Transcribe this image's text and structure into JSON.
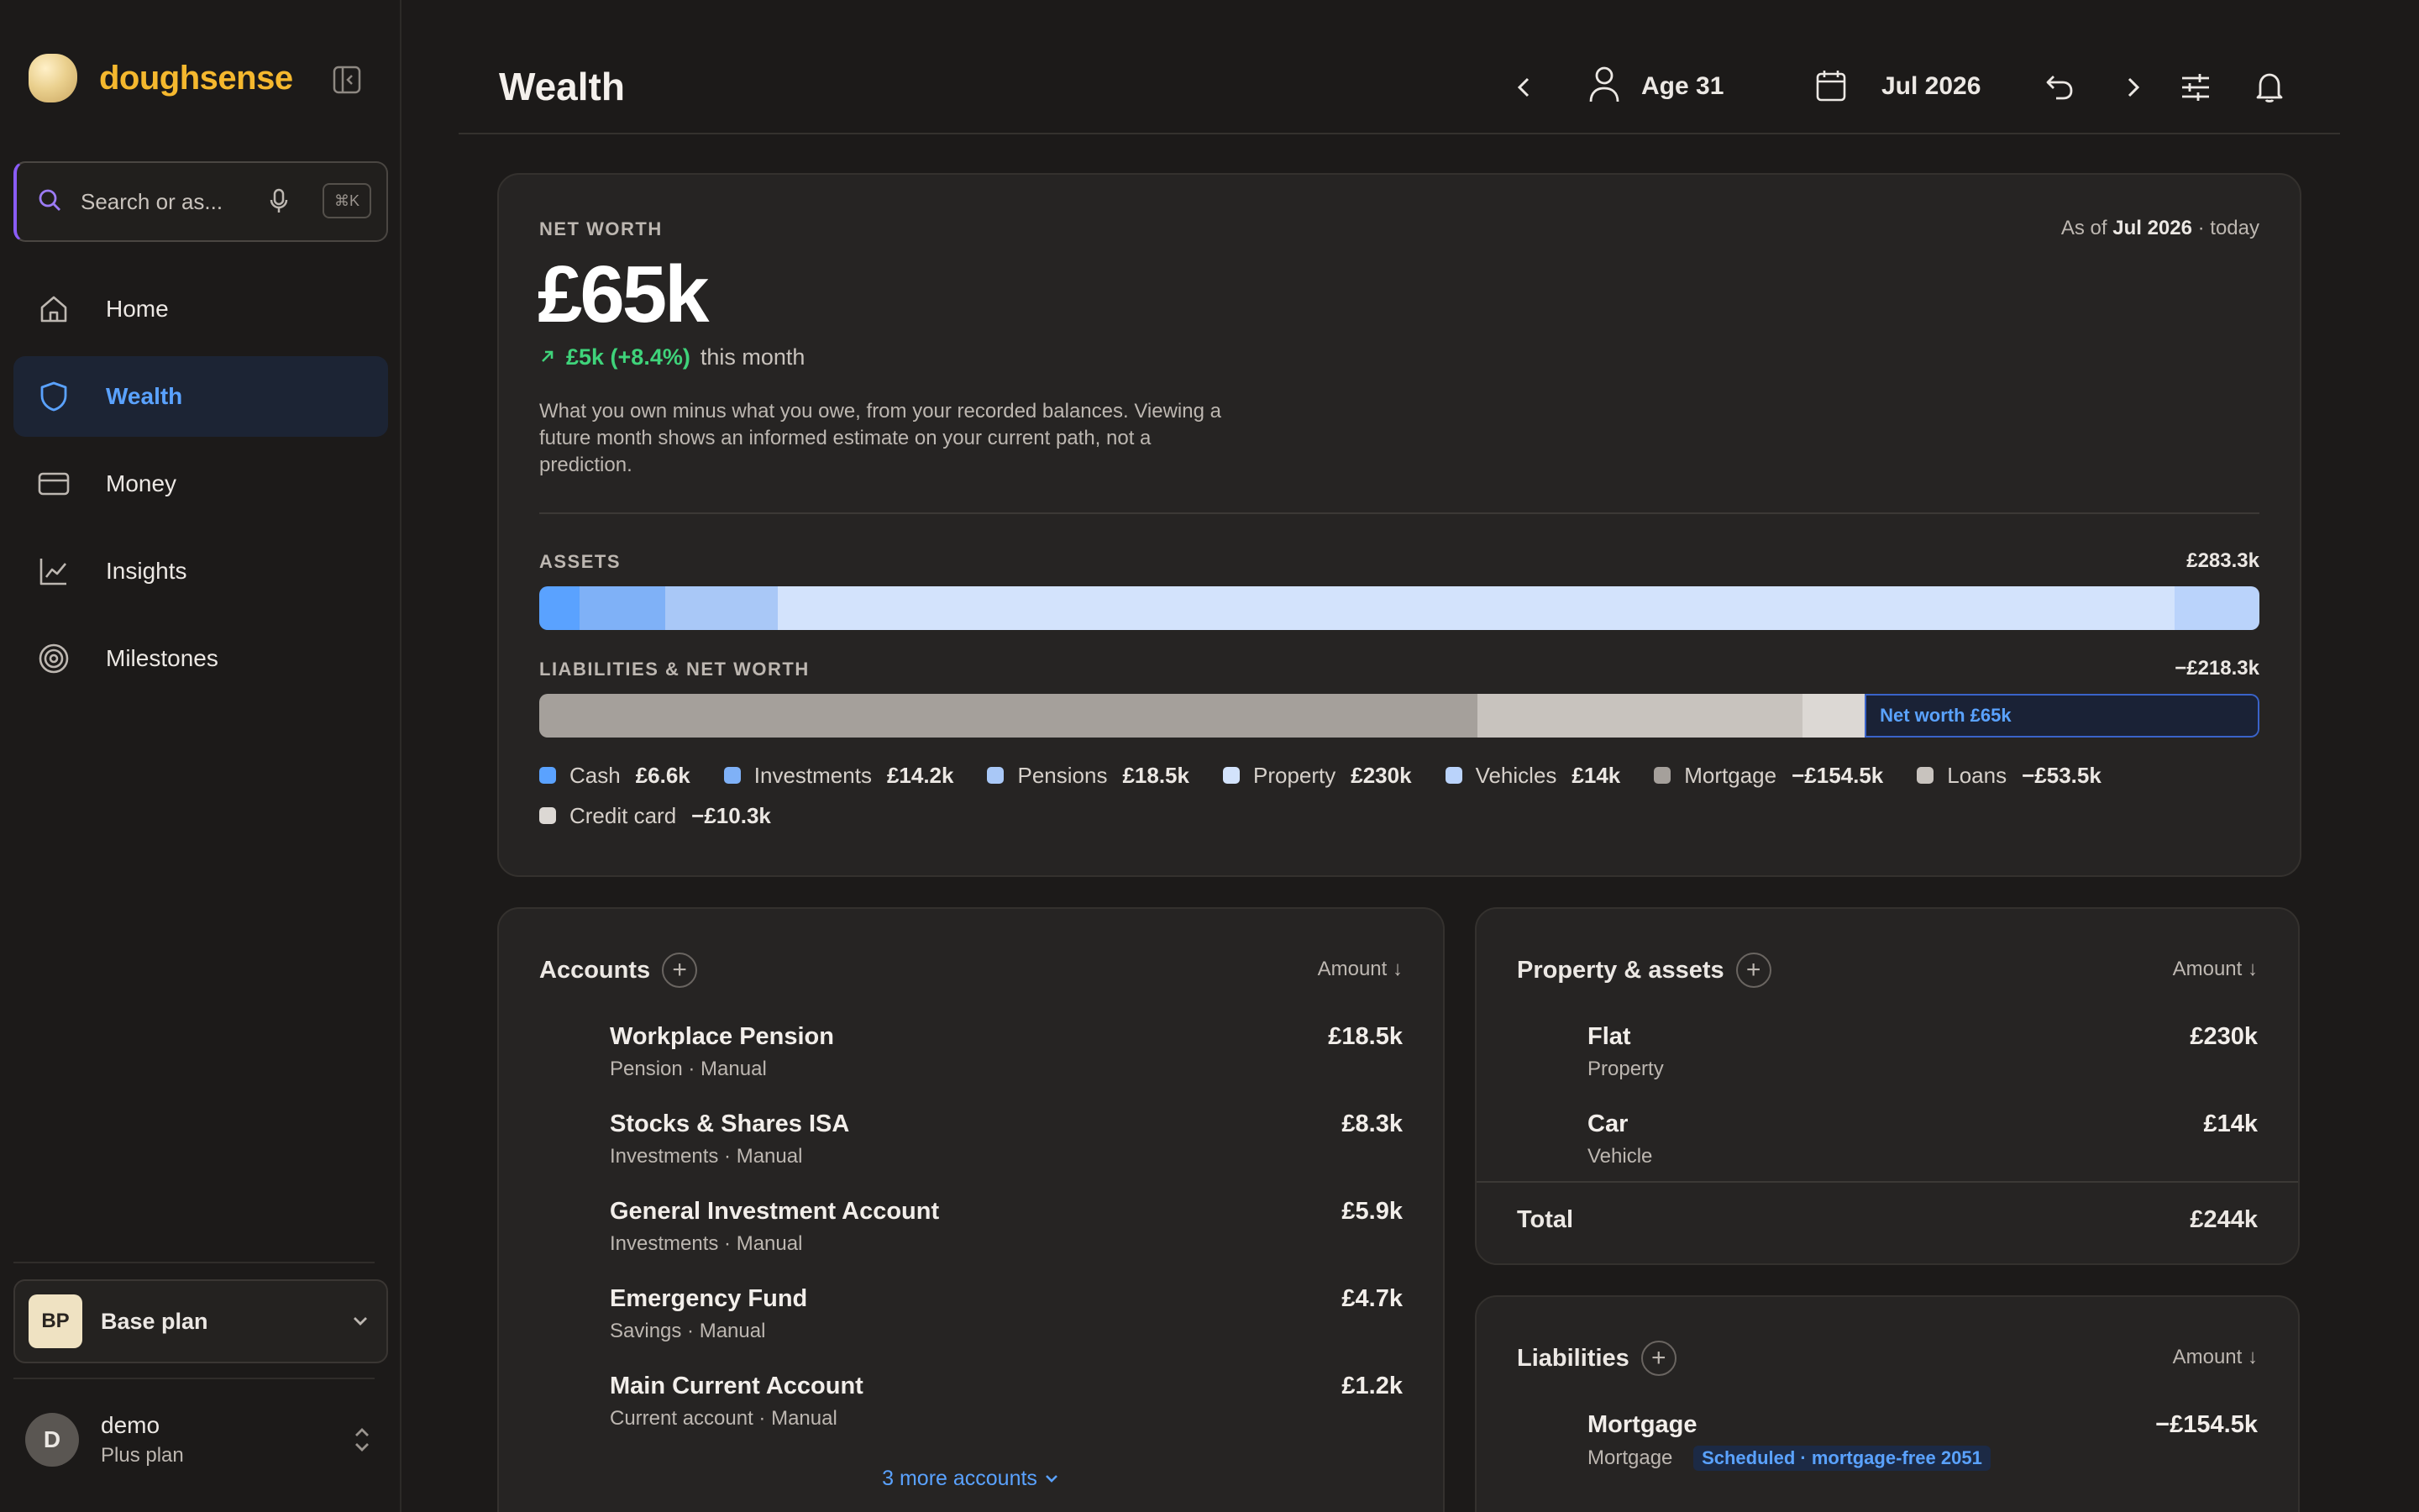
{
  "brand": {
    "name": "doughsense"
  },
  "search": {
    "placeholder": "Search or as...",
    "shortcut": "⌘K"
  },
  "nav": {
    "items": [
      {
        "label": "Home",
        "icon": "home-icon"
      },
      {
        "label": "Wealth",
        "icon": "shield-icon",
        "active": true
      },
      {
        "label": "Money",
        "icon": "card-icon"
      },
      {
        "label": "Insights",
        "icon": "chart-icon"
      },
      {
        "label": "Milestones",
        "icon": "target-icon"
      }
    ]
  },
  "plan": {
    "badge": "BP",
    "name": "Base plan"
  },
  "user": {
    "initial": "D",
    "name": "demo",
    "plan": "Plus plan"
  },
  "header": {
    "title": "Wealth",
    "age": "Age 31",
    "date": "Jul 2026"
  },
  "net_worth": {
    "label": "Net worth",
    "value": "£65k",
    "change": "£5k (+8.4%)",
    "change_suffix": "this month",
    "as_of_prefix": "As of",
    "as_of_date": "Jul 2026",
    "as_of_suffix": "· today",
    "description": "What you own minus what you owe, from your recorded balances. Viewing a future month shows an informed estimate on your current path, not a prediction.",
    "assets_label": "Assets",
    "assets_total": "£283.3k",
    "liabilities_label": "Liabilities & net worth",
    "liabilities_total": "−£218.3k",
    "net_worth_segment_label": "Net worth £65k"
  },
  "breakdown": {
    "assets": [
      {
        "name": "Cash",
        "value": "£6.6k",
        "amount": 6.6,
        "color": "#5aa2ff"
      },
      {
        "name": "Investments",
        "value": "£14.2k",
        "amount": 14.2,
        "color": "#7fb1f7"
      },
      {
        "name": "Pensions",
        "value": "£18.5k",
        "amount": 18.5,
        "color": "#a9c8f7"
      },
      {
        "name": "Property",
        "value": "£230k",
        "amount": 230,
        "color": "#d3e3fc"
      },
      {
        "name": "Vehicles",
        "value": "£14k",
        "amount": 14,
        "color": "#bad3fb"
      }
    ],
    "liabilities": [
      {
        "name": "Mortgage",
        "value": "−£154.5k",
        "amount": 154.5,
        "color": "#a5a09b"
      },
      {
        "name": "Loans",
        "value": "−£53.5k",
        "amount": 53.5,
        "color": "#c8c3be"
      },
      {
        "name": "Credit card",
        "value": "−£10.3k",
        "amount": 10.3,
        "color": "#dcd8d4"
      }
    ],
    "net_worth_amount": 65
  },
  "accounts": {
    "title": "Accounts",
    "sort": "Amount ↓",
    "items": [
      {
        "name": "Workplace Pension",
        "sub": "Pension · Manual",
        "amount": "£18.5k"
      },
      {
        "name": "Stocks & Shares ISA",
        "sub": "Investments · Manual",
        "amount": "£8.3k"
      },
      {
        "name": "General Investment Account",
        "sub": "Investments · Manual",
        "amount": "£5.9k"
      },
      {
        "name": "Emergency Fund",
        "sub": "Savings · Manual",
        "amount": "£4.7k"
      },
      {
        "name": "Main Current Account",
        "sub": "Current account · Manual",
        "amount": "£1.2k"
      }
    ],
    "more": "3 more accounts"
  },
  "property": {
    "title": "Property & assets",
    "sort": "Amount ↓",
    "items": [
      {
        "name": "Flat",
        "sub": "Property",
        "amount": "£230k"
      },
      {
        "name": "Car",
        "sub": "Vehicle",
        "amount": "£14k"
      }
    ],
    "total_label": "Total",
    "total": "£244k"
  },
  "liabilities": {
    "title": "Liabilities",
    "sort": "Amount ↓",
    "items": [
      {
        "name": "Mortgage",
        "sub": "Mortgage",
        "badge": "Scheduled · mortgage-free 2051",
        "amount": "−£154.5k"
      }
    ]
  }
}
